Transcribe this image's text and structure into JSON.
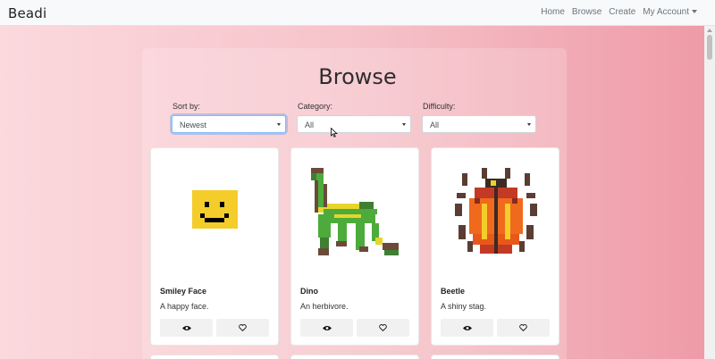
{
  "nav": {
    "brand": "Beadi",
    "links": [
      "Home",
      "Browse",
      "Create",
      "My Account"
    ]
  },
  "page": {
    "title": "Browse"
  },
  "filters": {
    "sort": {
      "label": "Sort by:",
      "value": "Newest"
    },
    "category": {
      "label": "Category:",
      "value": "All"
    },
    "difficulty": {
      "label": "Difficulty:",
      "value": "All"
    }
  },
  "cards": [
    {
      "title": "Smiley Face",
      "description": "A happy face."
    },
    {
      "title": "Dino",
      "description": "An herbivore."
    },
    {
      "title": "Beetle",
      "description": "A shiny stag."
    }
  ],
  "colors": {
    "smiley_yellow": "#f4cd2a",
    "dino_green": "#4cab3a",
    "dino_yellow": "#e7d52b",
    "beetle_orange": "#f06a1e",
    "brown": "#6b4a3a"
  },
  "icons": {
    "view": "eye-icon",
    "like": "heart-icon"
  }
}
